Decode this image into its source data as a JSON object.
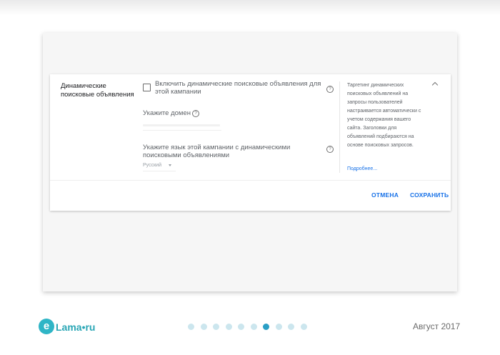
{
  "panel": {
    "section_title": "Динамические поисковые объявления",
    "enable_label": "Включить динамические поисковые объявления для этой кампании",
    "domain_label": "Укажите домен",
    "language_label": "Укажите язык этой кампании с динамическими поисковыми объявлениями",
    "language_value": "Русский",
    "help_glyph": "?",
    "info_text": "Таргетинг динамических поисковых объявлений на запросы пользователей настраивается автоматически с учетом содержания вашего сайта. Заголовки для объявлений подбираются на основе поисковых запросов.",
    "more_link": "Подробнее...",
    "cancel_label": "ОТМЕНА",
    "save_label": "СОХРАНИТЬ"
  },
  "footer": {
    "logo_letter": "e",
    "logo_text": "Lama•ru",
    "date": "Август 2017",
    "slide_count": 10,
    "active_slide": 7
  },
  "colors": {
    "accent": "#1a73e8",
    "brand": "#2fb5c6",
    "dot_active": "#2a9fc5",
    "dot_inactive": "#cce6ee"
  }
}
